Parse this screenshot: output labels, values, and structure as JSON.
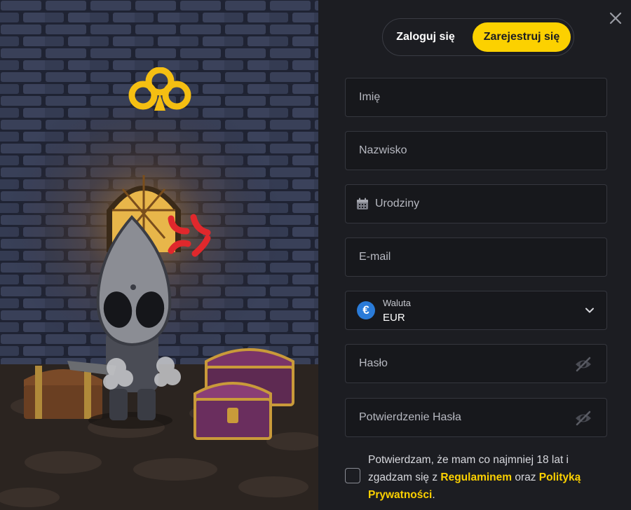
{
  "auth_tabs": {
    "login": "Zaloguj się",
    "register": "Zarejestruj się",
    "active": "register"
  },
  "form": {
    "first_name": {
      "placeholder": "Imię",
      "value": ""
    },
    "last_name": {
      "placeholder": "Nazwisko",
      "value": ""
    },
    "birthday": {
      "placeholder": "Urodziny",
      "value": "",
      "icon": "calendar-icon"
    },
    "email": {
      "placeholder": "E-mail",
      "value": ""
    },
    "currency": {
      "label": "Waluta",
      "value": "EUR",
      "symbol": "€",
      "icon": "euro-coin-icon"
    },
    "password": {
      "placeholder": "Hasło",
      "value": "",
      "icon": "eye-off-icon"
    },
    "password_confirm": {
      "placeholder": "Potwierdzenie Hasła",
      "value": "",
      "icon": "eye-off-icon"
    }
  },
  "consent": {
    "checked": false,
    "text_before": "Potwierdzam, że mam co najmniej 18 lat i zgadzam się z ",
    "terms_link": "Regulaminem",
    "text_middle": " oraz ",
    "privacy_link": "Polityką Prywatności",
    "text_after": "."
  },
  "colors": {
    "accent": "#fcd100",
    "background": "#1c1d22",
    "field_bg": "#17181c",
    "field_border": "#35373e"
  },
  "icons": {
    "close": "close-icon",
    "logo": "clover-logo-icon",
    "chevron": "chevron-down-icon"
  }
}
